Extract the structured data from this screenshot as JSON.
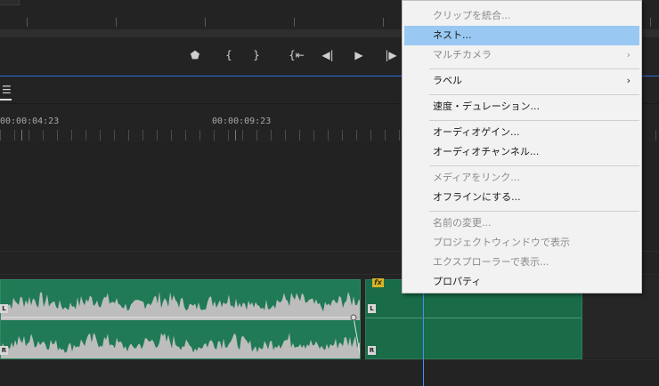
{
  "transport": {
    "buttons": [
      {
        "name": "marker-button",
        "glyph": "⬟"
      },
      {
        "name": "mark-in-button",
        "glyph": "{"
      },
      {
        "name": "mark-out-button",
        "glyph": "}"
      },
      {
        "name": "go-to-in-button",
        "glyph": "{⇤"
      },
      {
        "name": "step-back-button",
        "glyph": "◀|"
      },
      {
        "name": "play-button",
        "glyph": "▶"
      },
      {
        "name": "step-forward-button",
        "glyph": "|▶"
      }
    ]
  },
  "timeline": {
    "menu_glyph": "☰",
    "timecodes": [
      "00:00:04:23",
      "00:00:09:23"
    ],
    "fx_badge": "fx",
    "channel_labels": {
      "left": "L",
      "right": "R"
    }
  },
  "context_menu": {
    "items": [
      {
        "label": "クリップを統合...",
        "disabled": true
      },
      {
        "label": "ネスト...",
        "disabled": false,
        "highlight": true
      },
      {
        "label": "マルチカメラ",
        "disabled": true,
        "submenu": true
      },
      {
        "label": "ラベル",
        "disabled": false,
        "submenu": true
      },
      {
        "label": "速度・デュレーション...",
        "disabled": false
      },
      {
        "label": "オーディオゲイン...",
        "disabled": false
      },
      {
        "label": "オーディオチャンネル...",
        "disabled": false
      },
      {
        "label": "メディアをリンク...",
        "disabled": true
      },
      {
        "label": "オフラインにする...",
        "disabled": false
      },
      {
        "label": "名前の変更...",
        "disabled": true
      },
      {
        "label": "プロジェクトウィンドウで表示",
        "disabled": true
      },
      {
        "label": "エクスプローラーで表示...",
        "disabled": true
      },
      {
        "label": "プロパティ",
        "disabled": false
      }
    ],
    "submenu_arrow": "›"
  },
  "colors": {
    "clip_green": "#1f7a55",
    "menu_highlight": "#99c9f2",
    "playhead": "#4a8cff",
    "fx_badge": "#d8b427"
  }
}
